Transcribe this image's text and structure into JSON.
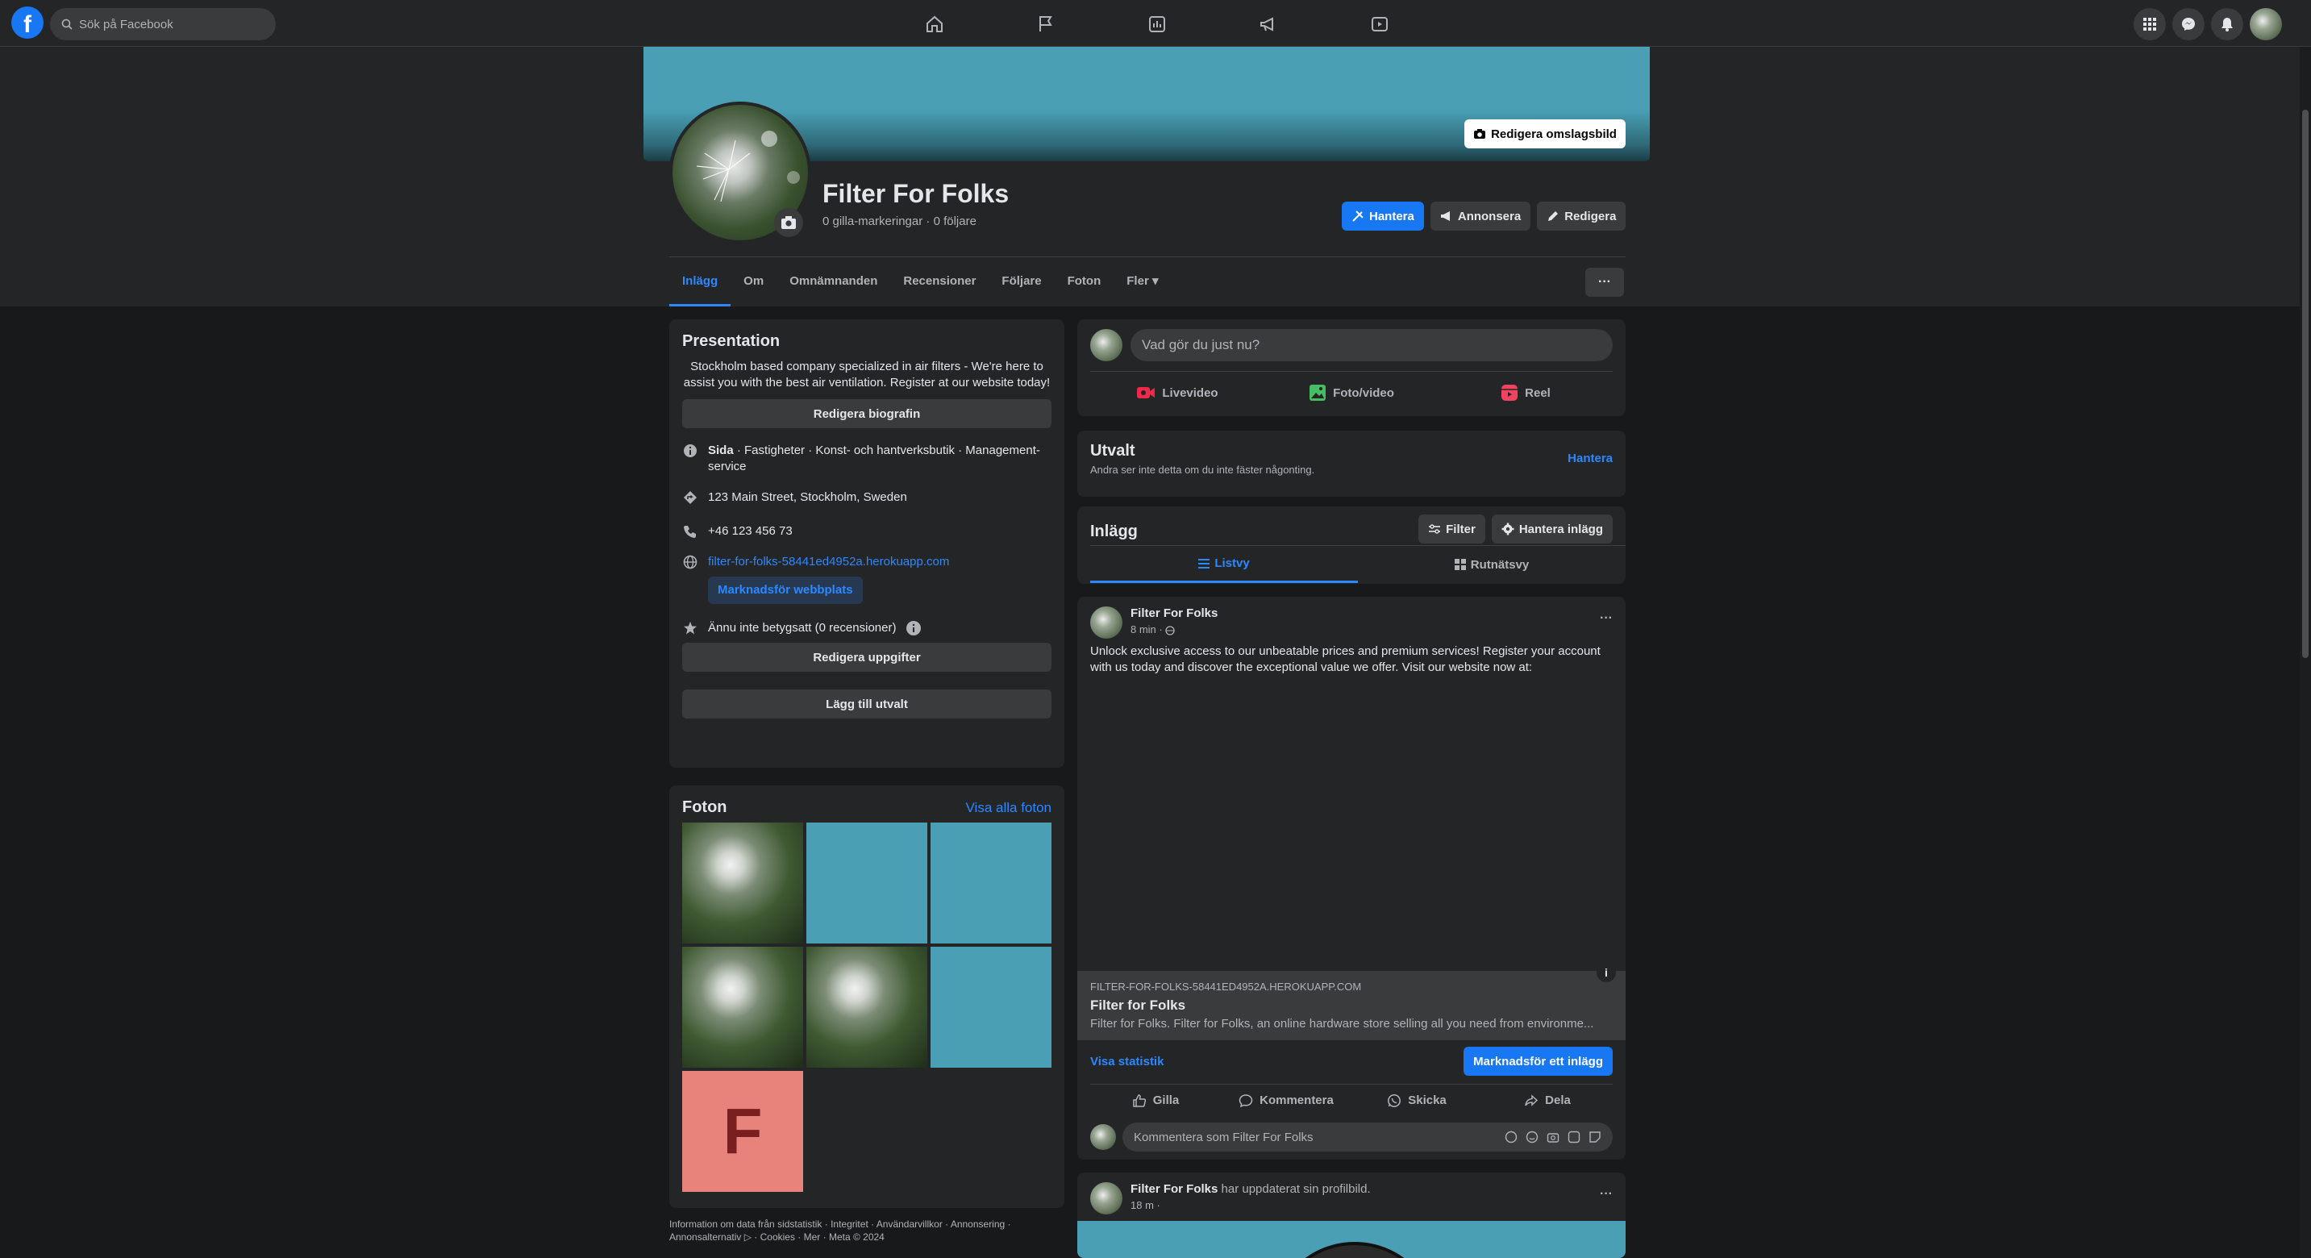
{
  "topbar": {
    "logo": "f",
    "search_placeholder": "Sök på Facebook",
    "nav_icons": [
      "home-icon",
      "flag-icon",
      "insights-icon",
      "megaphone-icon",
      "video-icon"
    ],
    "right_icons": [
      "apps-grid-icon",
      "messenger-icon",
      "bell-icon",
      "account-avatar"
    ]
  },
  "header": {
    "cover_button": "Redigera omslagsbild",
    "page_name": "Filter For Folks",
    "likes": "0 gilla-markeringar",
    "separator": "·",
    "followers": "0 följare",
    "buttons": {
      "manage": "Hantera",
      "advertise": "Annonsera",
      "edit": "Redigera"
    },
    "more": "···"
  },
  "tabs": [
    "Inlägg",
    "Om",
    "Omnämnanden",
    "Recensioner",
    "Följare",
    "Foton",
    "Fler ▾"
  ],
  "intro": {
    "title": "Presentation",
    "bio": "Stockholm based company specialized in air filters - We're here to assist you with the best air ventilation. Register at our website today!",
    "edit_bio": "Redigera biografin",
    "category_label": "Sida",
    "category_text": " · Fastigheter · Konst- och hantverksbutik · Management-service",
    "address": "123 Main Street, Stockholm, Sweden",
    "phone": "+46 123 456 73",
    "website": "filter-for-folks-58441ed4952a.herokuapp.com",
    "promote_website": "Marknadsför webbplats",
    "rating": "Ännu inte betygsatt (0 recensioner)",
    "edit_details": "Redigera uppgifter",
    "add_featured": "Lägg till utvalt"
  },
  "photos": {
    "title": "Foton",
    "see_all": "Visa alla foton",
    "letter_tile": "F"
  },
  "footer": "Information om data från sidstatistik · Integritet · Användarvillkor · Annonsering · Annonsalternativ ▷ · Cookies · Mer · Meta © 2024",
  "composer": {
    "placeholder": "Vad gör du just nu?",
    "live": "Livevideo",
    "photo": "Foto/video",
    "reel": "Reel"
  },
  "featured": {
    "title": "Utvalt",
    "subtitle": "Andra ser inte detta om du inte fäster någonting.",
    "manage": "Hantera"
  },
  "posts_header": {
    "title": "Inlägg",
    "filter": "Filter",
    "manage_posts": "Hantera inlägg",
    "list_view": "Listvy",
    "grid_view": "Rutnätsvy"
  },
  "post1": {
    "author": "Filter For Folks",
    "time": "8 min ·",
    "text": "Unlock exclusive access to our unbeatable prices and premium services! Register your account with us today and discover the exceptional value we offer. Visit our website now at:",
    "link_domain": "FILTER-FOR-FOLKS-58441ED4952A.HEROKUAPP.COM",
    "link_title": "Filter for Folks",
    "link_desc": "Filter for Folks. Filter for Folks, an online hardware store selling all you need from environme...",
    "view_stats": "Visa statistik",
    "promote_post": "Marknadsför ett inlägg",
    "like": "Gilla",
    "comment": "Kommentera",
    "send": "Skicka",
    "share": "Dela",
    "comment_placeholder": "Kommentera som Filter For Folks"
  },
  "post2": {
    "author": "Filter For Folks",
    "action": " har uppdaterat sin profilbild.",
    "time": "18 m ·"
  },
  "colors": {
    "accent": "#2d88ff",
    "primary_button": "#1877f2",
    "cover": "#4a9fb5",
    "tile_pink": "#e8837c"
  }
}
